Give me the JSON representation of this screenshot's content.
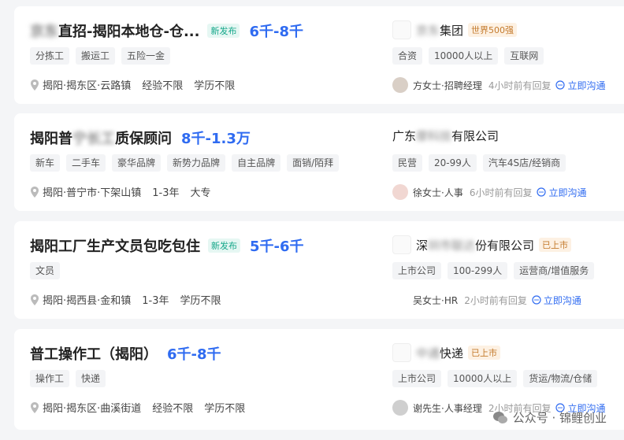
{
  "jobs": [
    {
      "title_blur": "京东",
      "title": "直招-揭阳本地仓-仓...",
      "badge": "新发布",
      "salary": "6千-8千",
      "tags": [
        "分拣工",
        "搬运工",
        "五险一金"
      ],
      "location": "揭阳·揭东区·云路镇",
      "experience": "经验不限",
      "education": "学历不限",
      "company_blur": "京东",
      "company": "集团",
      "company_badge": "世界500强",
      "company_tags": [
        "合资",
        "10000人以上",
        "互联网"
      ],
      "recruiter": "方女士·招聘经理",
      "reply": "4小时前有回复",
      "chat": "立即沟通"
    },
    {
      "title": "揭阳普",
      "title_blur": "宁长工",
      "title_tail": "质保顾问",
      "badge": "",
      "salary": "8千-1.3万",
      "tags": [
        "新车",
        "二手车",
        "豪华品牌",
        "新势力品牌",
        "自主品牌",
        "面销/陌拜"
      ],
      "location": "揭阳·普宁市·下架山镇",
      "experience": "1-3年",
      "education": "大专",
      "company_pre": "广东",
      "company_blur": "摩科技",
      "company": "有限公司",
      "company_badge": "",
      "company_tags": [
        "民营",
        "20-99人",
        "汽车4S店/经销商"
      ],
      "recruiter": "徐女士·人事",
      "reply": "6小时前有回复",
      "chat": "立即沟通"
    },
    {
      "title": "揭阳工厂生产文员包吃包住",
      "badge": "新发布",
      "salary": "5千-6千",
      "tags": [
        "文员"
      ],
      "location": "揭阳·揭西县·金和镇",
      "experience": "1-3年",
      "education": "学历不限",
      "company_pre": "深",
      "company_blur": "圳市联达",
      "company": "份有限公司",
      "company_badge": "已上市",
      "company_tags": [
        "上市公司",
        "100-299人",
        "运营商/增值服务"
      ],
      "recruiter": "吴女士·HR",
      "reply": "2小时前有回复",
      "chat": "立即沟通"
    },
    {
      "title": "普工操作工（揭阳）",
      "badge": "",
      "salary": "6千-8千",
      "tags": [
        "操作工",
        "快递"
      ],
      "location": "揭阳·揭东区·曲溪街道",
      "experience": "经验不限",
      "education": "学历不限",
      "company_blur": "中通",
      "company": "快递",
      "company_badge": "已上市",
      "company_tags": [
        "上市公司",
        "10000人以上",
        "货运/物流/仓储"
      ],
      "recruiter": "谢先生·人事经理",
      "reply": "2小时前有回复",
      "chat": "立即沟通"
    }
  ],
  "watermark": "公众号 · 锦鲤创业",
  "colors": {
    "salary": "#2f6bf1",
    "new_badge": "#16a78a",
    "org_badge": "#c47a2c",
    "page_bg": "#f4f5f7"
  }
}
